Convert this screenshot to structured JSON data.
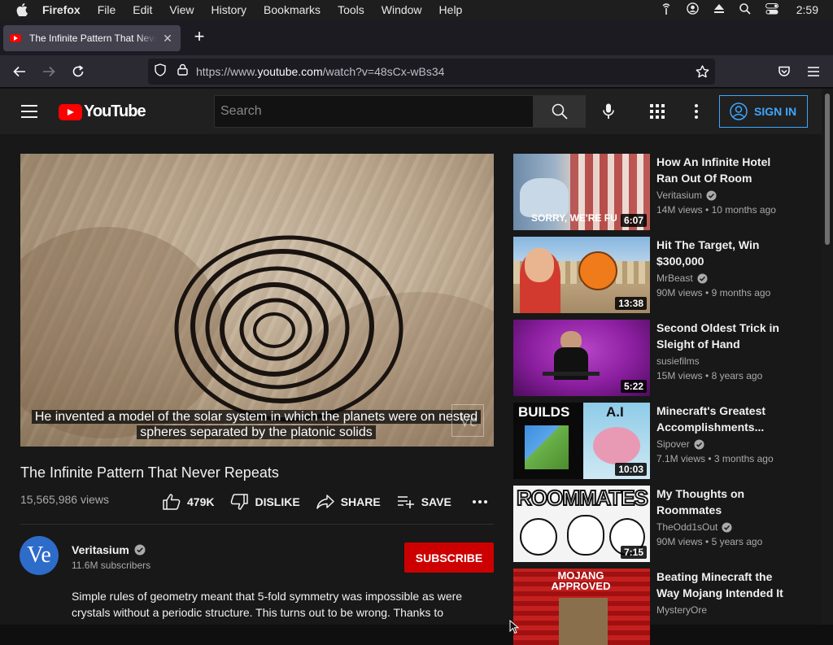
{
  "menubar": {
    "app": "Firefox",
    "items": [
      "File",
      "Edit",
      "View",
      "History",
      "Bookmarks",
      "Tools",
      "Window",
      "Help"
    ],
    "clock": "2:59"
  },
  "browser": {
    "tab_title": "The Infinite Pattern That Never Repeats",
    "url_prefix": "https://www.",
    "url_domain": "youtube.com",
    "url_path": "/watch?v=48sCx-wBs34"
  },
  "youtube": {
    "logo_text": "YouTube",
    "search_placeholder": "Search",
    "sign_in": "SIGN IN"
  },
  "video": {
    "caption_line1": "He invented a model of the solar system in which the planets were on nested",
    "caption_line2": "spheres separated by the platonic solids",
    "watermark": "Ve",
    "title": "The Infinite Pattern That Never Repeats",
    "views": "15,565,986 views",
    "likes": "479K",
    "dislike": "DISLIKE",
    "share": "SHARE",
    "save": "SAVE"
  },
  "channel": {
    "avatar_text": "Ve",
    "name": "Veritasium",
    "subscribers": "11.6M subscribers",
    "subscribe": "SUBSCRIBE",
    "description": "Simple rules of geometry meant that 5-fold symmetry was impossible as were crystals without a periodic structure. This turns out to be wrong. Thanks to"
  },
  "recommendations": [
    {
      "title": "How An Infinite Hotel Ran Out Of Room",
      "channel": "Veritasium",
      "verified": true,
      "views": "14M views",
      "age": "10 months ago",
      "duration": "6:07",
      "thumb_text": "SORRY, WE'RE FU"
    },
    {
      "title": "Hit The Target, Win $300,000",
      "channel": "MrBeast",
      "verified": true,
      "views": "90M views",
      "age": "9 months ago",
      "duration": "13:38",
      "thumb_text": ""
    },
    {
      "title": "Second Oldest Trick in Sleight of Hand",
      "channel": "susiefilms",
      "verified": false,
      "views": "15M views",
      "age": "8 years ago",
      "duration": "5:22",
      "thumb_text": ""
    },
    {
      "title": "Minecraft's Greatest Accomplishments...",
      "channel": "Sipover",
      "verified": true,
      "views": "7.1M views",
      "age": "3 months ago",
      "duration": "10:03",
      "thumb_text": "BUILDS",
      "thumb_text2": "A.I"
    },
    {
      "title": "My Thoughts on Roommates",
      "channel": "TheOdd1sOut",
      "verified": true,
      "views": "90M views",
      "age": "5 years ago",
      "duration": "7:15",
      "thumb_text": "ROOMMATES"
    },
    {
      "title": "Beating Minecraft the Way Mojang Intended It",
      "channel": "MysteryOre",
      "verified": false,
      "views": "",
      "age": "",
      "duration": "",
      "thumb_text": "MOJANG APPROVED"
    }
  ]
}
